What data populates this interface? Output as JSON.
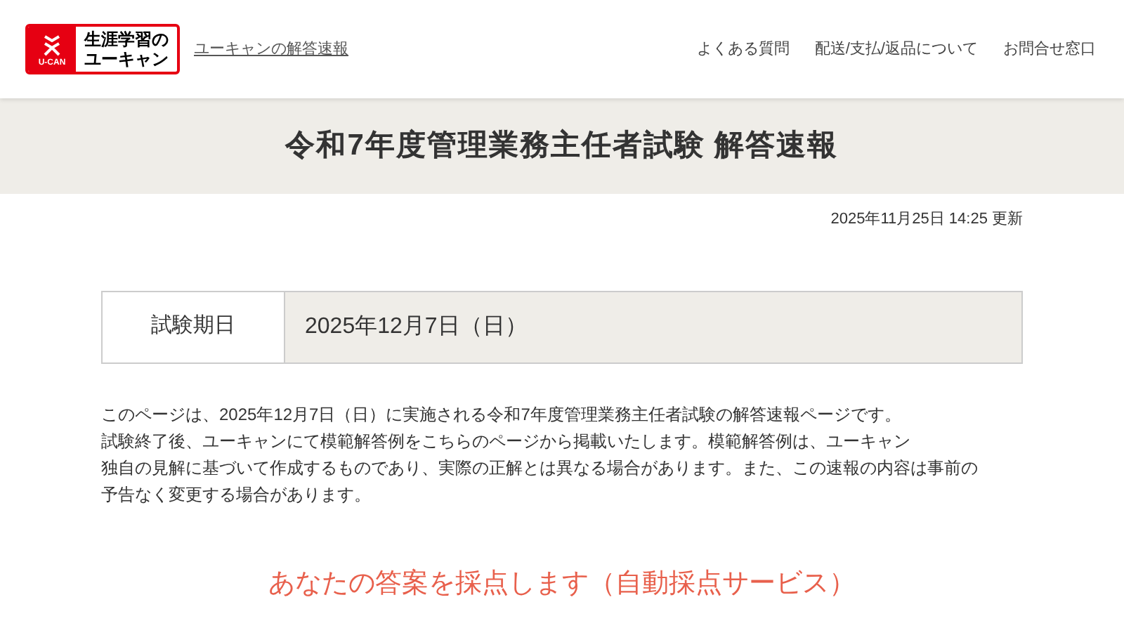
{
  "header": {
    "logo": {
      "badge": "U-CAN",
      "lines": [
        "生涯学習の",
        "ユーキャン"
      ]
    },
    "site_link": "ユーキャンの解答速報",
    "nav": [
      "よくある質問",
      "配送/支払/返品について",
      "お問合せ窓口"
    ]
  },
  "title": "令和7年度管理業務主任者試験 解答速報",
  "updated": "2025年11月25日 14:25 更新",
  "exam_table": [
    {
      "label": "試験期日",
      "value": "2025年12月7日（日）"
    }
  ],
  "intro": [
    "このページは、2025年12月7日（日）に実施される令和7年度管理業務主任者試験の解答速報ページです。",
    "試験終了後、ユーキャンにて模範解答例をこちらのページから掲載いたします。模範解答例は、ユーキャン",
    "独自の見解に基づいて作成するものであり、実際の正解とは異なる場合があります。また、この速報の内容は事前の",
    "予告なく変更する場合があります。"
  ],
  "section_heading": "あなたの答案を採点します（自動採点サービス）"
}
